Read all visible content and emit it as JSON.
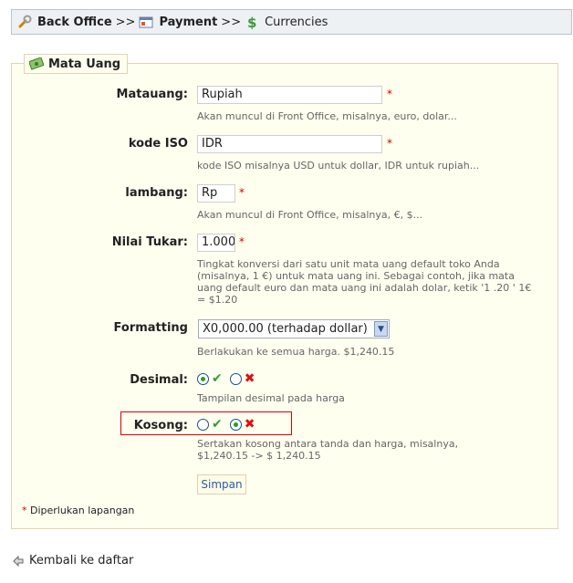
{
  "breadcrumb": {
    "item1": "Back Office",
    "sep1": ">>",
    "item2": "Payment",
    "sep2": ">>",
    "item3": "Currencies"
  },
  "form": {
    "legend": "Mata Uang",
    "fields": {
      "name": {
        "label": "Matauang:",
        "value": "Rupiah",
        "hint": "Akan muncul di Front Office, misalnya, euro, dolar..."
      },
      "iso": {
        "label": "kode ISO",
        "value": "IDR",
        "hint": "kode ISO misalnya USD untuk dollar, IDR untuk rupiah..."
      },
      "sign": {
        "label": "lambang:",
        "value": "Rp",
        "hint": "Akan muncul di Front Office, misalnya, €, $..."
      },
      "rate": {
        "label": "Nilai Tukar:",
        "value": "1.000",
        "hint_lines": [
          "Tingkat konversi dari satu unit mata uang default toko Anda",
          "(misalnya, 1 €) untuk mata uang ini. Sebagai contoh, jika mata",
          "uang default euro dan mata uang ini adalah dolar, ketik '1 .20 ' 1€",
          "= $1.20"
        ]
      },
      "format": {
        "label": "Formatting",
        "value": "X0,000.00 (terhadap dollar)",
        "hint": "Berlakukan ke semua harga. $1,240.15"
      },
      "decimals": {
        "label": "Desimal:",
        "selected": "yes",
        "hint": "Tampilan desimal pada harga"
      },
      "blank": {
        "label": "Kosong:",
        "selected": "no",
        "hint_lines": [
          "Sertakan kosong antara tanda dan harga, misalnya,",
          "$1,240.15 -> $ 1,240.15"
        ]
      }
    },
    "required_mark": "*",
    "submit_label": "Simpan",
    "required_note": "Diperlukan lapangan"
  },
  "back_link": "Kembali ke daftar",
  "colors": {
    "required": "#cc0000",
    "check": "#2f9e2f",
    "cross": "#dd1111",
    "highlight": "#dd0000"
  },
  "icons": [
    "wrench-icon",
    "payment-icon",
    "dollar-icon",
    "money-icon",
    "back-arrow-icon",
    "check-icon",
    "cross-icon"
  ]
}
